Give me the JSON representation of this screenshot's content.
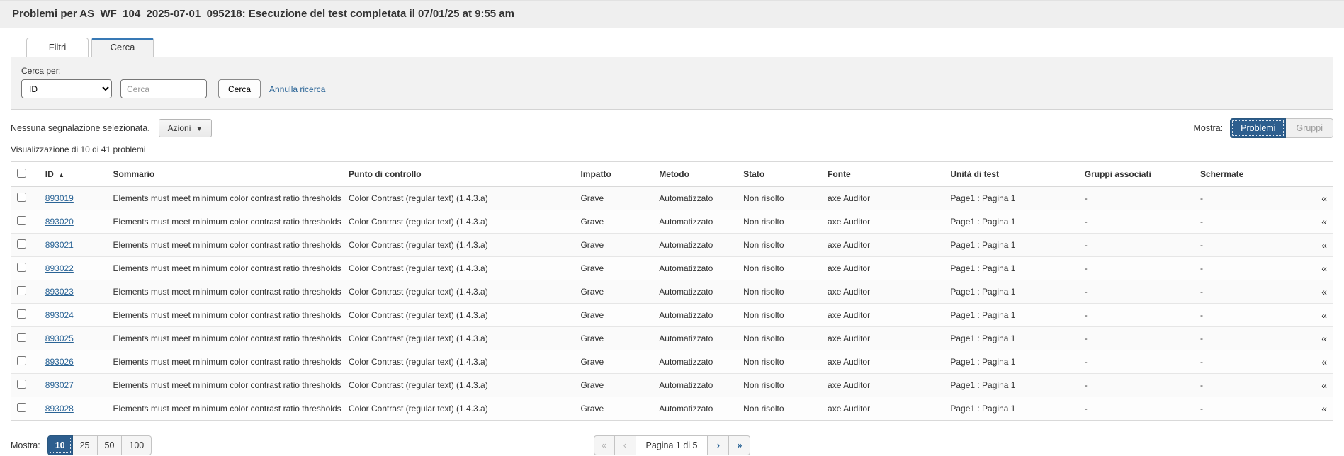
{
  "header": {
    "title": "Problemi per AS_WF_104_2025-07-01_095218: Esecuzione del test completata il 07/01/25 at 9:55 am"
  },
  "tabs": [
    {
      "label": "Filtri"
    },
    {
      "label": "Cerca"
    }
  ],
  "search": {
    "label": "Cerca per:",
    "field_selected": "ID",
    "input_placeholder": "Cerca",
    "input_value": "",
    "submit_label": "Cerca",
    "cancel_label": "Annulla ricerca"
  },
  "toolbar": {
    "selection_status": "Nessuna segnalazione selezionata.",
    "actions_label": "Azioni",
    "actions_caret": "▼",
    "show_label": "Mostra:",
    "view_problems": "Problemi",
    "view_groups": "Gruppi"
  },
  "summary": "Visualizzazione di 10 di 41 problemi",
  "table": {
    "columns": [
      "ID",
      "Sommario",
      "Punto di controllo",
      "Impatto",
      "Metodo",
      "Stato",
      "Fonte",
      "Unità di test",
      "Gruppi associati",
      "Schermate"
    ],
    "sort_column": "ID",
    "sort_direction": "asc",
    "sort_icon": "▲",
    "collapse_icon": "«",
    "rows": [
      {
        "id": "893019",
        "sommario": "Elements must meet minimum color contrast ratio thresholds",
        "punto_di_controllo": "Color Contrast (regular text) (1.4.3.a)",
        "impatto": "Grave",
        "metodo": "Automatizzato",
        "stato": "Non risolto",
        "fonte": "axe Auditor",
        "unita_di_test": "Page1 : Pagina 1",
        "gruppi_associati": "-",
        "schermate": "-"
      },
      {
        "id": "893020",
        "sommario": "Elements must meet minimum color contrast ratio thresholds",
        "punto_di_controllo": "Color Contrast (regular text) (1.4.3.a)",
        "impatto": "Grave",
        "metodo": "Automatizzato",
        "stato": "Non risolto",
        "fonte": "axe Auditor",
        "unita_di_test": "Page1 : Pagina 1",
        "gruppi_associati": "-",
        "schermate": "-"
      },
      {
        "id": "893021",
        "sommario": "Elements must meet minimum color contrast ratio thresholds",
        "punto_di_controllo": "Color Contrast (regular text) (1.4.3.a)",
        "impatto": "Grave",
        "metodo": "Automatizzato",
        "stato": "Non risolto",
        "fonte": "axe Auditor",
        "unita_di_test": "Page1 : Pagina 1",
        "gruppi_associati": "-",
        "schermate": "-"
      },
      {
        "id": "893022",
        "sommario": "Elements must meet minimum color contrast ratio thresholds",
        "punto_di_controllo": "Color Contrast (regular text) (1.4.3.a)",
        "impatto": "Grave",
        "metodo": "Automatizzato",
        "stato": "Non risolto",
        "fonte": "axe Auditor",
        "unita_di_test": "Page1 : Pagina 1",
        "gruppi_associati": "-",
        "schermate": "-"
      },
      {
        "id": "893023",
        "sommario": "Elements must meet minimum color contrast ratio thresholds",
        "punto_di_controllo": "Color Contrast (regular text) (1.4.3.a)",
        "impatto": "Grave",
        "metodo": "Automatizzato",
        "stato": "Non risolto",
        "fonte": "axe Auditor",
        "unita_di_test": "Page1 : Pagina 1",
        "gruppi_associati": "-",
        "schermate": "-"
      },
      {
        "id": "893024",
        "sommario": "Elements must meet minimum color contrast ratio thresholds",
        "punto_di_controllo": "Color Contrast (regular text) (1.4.3.a)",
        "impatto": "Grave",
        "metodo": "Automatizzato",
        "stato": "Non risolto",
        "fonte": "axe Auditor",
        "unita_di_test": "Page1 : Pagina 1",
        "gruppi_associati": "-",
        "schermate": "-"
      },
      {
        "id": "893025",
        "sommario": "Elements must meet minimum color contrast ratio thresholds",
        "punto_di_controllo": "Color Contrast (regular text) (1.4.3.a)",
        "impatto": "Grave",
        "metodo": "Automatizzato",
        "stato": "Non risolto",
        "fonte": "axe Auditor",
        "unita_di_test": "Page1 : Pagina 1",
        "gruppi_associati": "-",
        "schermate": "-"
      },
      {
        "id": "893026",
        "sommario": "Elements must meet minimum color contrast ratio thresholds",
        "punto_di_controllo": "Color Contrast (regular text) (1.4.3.a)",
        "impatto": "Grave",
        "metodo": "Automatizzato",
        "stato": "Non risolto",
        "fonte": "axe Auditor",
        "unita_di_test": "Page1 : Pagina 1",
        "gruppi_associati": "-",
        "schermate": "-"
      },
      {
        "id": "893027",
        "sommario": "Elements must meet minimum color contrast ratio thresholds",
        "punto_di_controllo": "Color Contrast (regular text) (1.4.3.a)",
        "impatto": "Grave",
        "metodo": "Automatizzato",
        "stato": "Non risolto",
        "fonte": "axe Auditor",
        "unita_di_test": "Page1 : Pagina 1",
        "gruppi_associati": "-",
        "schermate": "-"
      },
      {
        "id": "893028",
        "sommario": "Elements must meet minimum color contrast ratio thresholds",
        "punto_di_controllo": "Color Contrast (regular text) (1.4.3.a)",
        "impatto": "Grave",
        "metodo": "Automatizzato",
        "stato": "Non risolto",
        "fonte": "axe Auditor",
        "unita_di_test": "Page1 : Pagina 1",
        "gruppi_associati": "-",
        "schermate": "-"
      }
    ]
  },
  "footer": {
    "page_size_label": "Mostra:",
    "page_sizes": [
      "10",
      "25",
      "50",
      "100"
    ],
    "active_page_size": "10",
    "pagination": {
      "first": "«",
      "prev": "‹",
      "label": "Pagina 1 di 5",
      "next": "›",
      "last": "»"
    }
  },
  "colors": {
    "accent": "#2d5e8e",
    "tab_accent": "#3879b5",
    "link": "#2a6496"
  }
}
